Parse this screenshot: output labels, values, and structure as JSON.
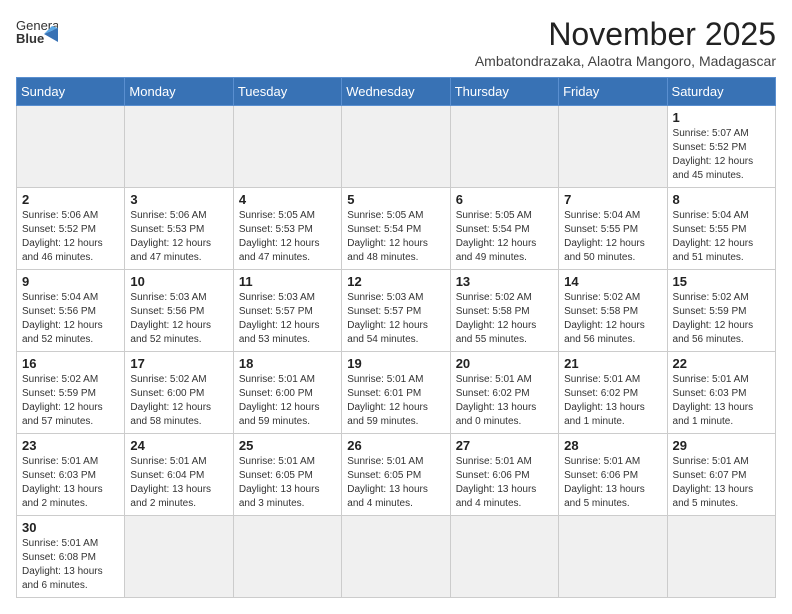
{
  "logo": {
    "line1": "General",
    "line2": "Blue"
  },
  "title": "November 2025",
  "subtitle": "Ambatondrazaka, Alaotra Mangoro, Madagascar",
  "weekdays": [
    "Sunday",
    "Monday",
    "Tuesday",
    "Wednesday",
    "Thursday",
    "Friday",
    "Saturday"
  ],
  "days": [
    {
      "num": "",
      "info": ""
    },
    {
      "num": "",
      "info": ""
    },
    {
      "num": "",
      "info": ""
    },
    {
      "num": "",
      "info": ""
    },
    {
      "num": "",
      "info": ""
    },
    {
      "num": "",
      "info": ""
    },
    {
      "num": "1",
      "info": "Sunrise: 5:07 AM\nSunset: 5:52 PM\nDaylight: 12 hours\nand 45 minutes."
    },
    {
      "num": "2",
      "info": "Sunrise: 5:06 AM\nSunset: 5:52 PM\nDaylight: 12 hours\nand 46 minutes."
    },
    {
      "num": "3",
      "info": "Sunrise: 5:06 AM\nSunset: 5:53 PM\nDaylight: 12 hours\nand 47 minutes."
    },
    {
      "num": "4",
      "info": "Sunrise: 5:05 AM\nSunset: 5:53 PM\nDaylight: 12 hours\nand 47 minutes."
    },
    {
      "num": "5",
      "info": "Sunrise: 5:05 AM\nSunset: 5:54 PM\nDaylight: 12 hours\nand 48 minutes."
    },
    {
      "num": "6",
      "info": "Sunrise: 5:05 AM\nSunset: 5:54 PM\nDaylight: 12 hours\nand 49 minutes."
    },
    {
      "num": "7",
      "info": "Sunrise: 5:04 AM\nSunset: 5:55 PM\nDaylight: 12 hours\nand 50 minutes."
    },
    {
      "num": "8",
      "info": "Sunrise: 5:04 AM\nSunset: 5:55 PM\nDaylight: 12 hours\nand 51 minutes."
    },
    {
      "num": "9",
      "info": "Sunrise: 5:04 AM\nSunset: 5:56 PM\nDaylight: 12 hours\nand 52 minutes."
    },
    {
      "num": "10",
      "info": "Sunrise: 5:03 AM\nSunset: 5:56 PM\nDaylight: 12 hours\nand 52 minutes."
    },
    {
      "num": "11",
      "info": "Sunrise: 5:03 AM\nSunset: 5:57 PM\nDaylight: 12 hours\nand 53 minutes."
    },
    {
      "num": "12",
      "info": "Sunrise: 5:03 AM\nSunset: 5:57 PM\nDaylight: 12 hours\nand 54 minutes."
    },
    {
      "num": "13",
      "info": "Sunrise: 5:02 AM\nSunset: 5:58 PM\nDaylight: 12 hours\nand 55 minutes."
    },
    {
      "num": "14",
      "info": "Sunrise: 5:02 AM\nSunset: 5:58 PM\nDaylight: 12 hours\nand 56 minutes."
    },
    {
      "num": "15",
      "info": "Sunrise: 5:02 AM\nSunset: 5:59 PM\nDaylight: 12 hours\nand 56 minutes."
    },
    {
      "num": "16",
      "info": "Sunrise: 5:02 AM\nSunset: 5:59 PM\nDaylight: 12 hours\nand 57 minutes."
    },
    {
      "num": "17",
      "info": "Sunrise: 5:02 AM\nSunset: 6:00 PM\nDaylight: 12 hours\nand 58 minutes."
    },
    {
      "num": "18",
      "info": "Sunrise: 5:01 AM\nSunset: 6:00 PM\nDaylight: 12 hours\nand 59 minutes."
    },
    {
      "num": "19",
      "info": "Sunrise: 5:01 AM\nSunset: 6:01 PM\nDaylight: 12 hours\nand 59 minutes."
    },
    {
      "num": "20",
      "info": "Sunrise: 5:01 AM\nSunset: 6:02 PM\nDaylight: 13 hours\nand 0 minutes."
    },
    {
      "num": "21",
      "info": "Sunrise: 5:01 AM\nSunset: 6:02 PM\nDaylight: 13 hours\nand 1 minute."
    },
    {
      "num": "22",
      "info": "Sunrise: 5:01 AM\nSunset: 6:03 PM\nDaylight: 13 hours\nand 1 minute."
    },
    {
      "num": "23",
      "info": "Sunrise: 5:01 AM\nSunset: 6:03 PM\nDaylight: 13 hours\nand 2 minutes."
    },
    {
      "num": "24",
      "info": "Sunrise: 5:01 AM\nSunset: 6:04 PM\nDaylight: 13 hours\nand 2 minutes."
    },
    {
      "num": "25",
      "info": "Sunrise: 5:01 AM\nSunset: 6:05 PM\nDaylight: 13 hours\nand 3 minutes."
    },
    {
      "num": "26",
      "info": "Sunrise: 5:01 AM\nSunset: 6:05 PM\nDaylight: 13 hours\nand 4 minutes."
    },
    {
      "num": "27",
      "info": "Sunrise: 5:01 AM\nSunset: 6:06 PM\nDaylight: 13 hours\nand 4 minutes."
    },
    {
      "num": "28",
      "info": "Sunrise: 5:01 AM\nSunset: 6:06 PM\nDaylight: 13 hours\nand 5 minutes."
    },
    {
      "num": "29",
      "info": "Sunrise: 5:01 AM\nSunset: 6:07 PM\nDaylight: 13 hours\nand 5 minutes."
    },
    {
      "num": "30",
      "info": "Sunrise: 5:01 AM\nSunset: 6:08 PM\nDaylight: 13 hours\nand 6 minutes."
    },
    {
      "num": "",
      "info": ""
    },
    {
      "num": "",
      "info": ""
    },
    {
      "num": "",
      "info": ""
    },
    {
      "num": "",
      "info": ""
    },
    {
      "num": "",
      "info": ""
    },
    {
      "num": "",
      "info": ""
    },
    {
      "num": "",
      "info": ""
    }
  ]
}
